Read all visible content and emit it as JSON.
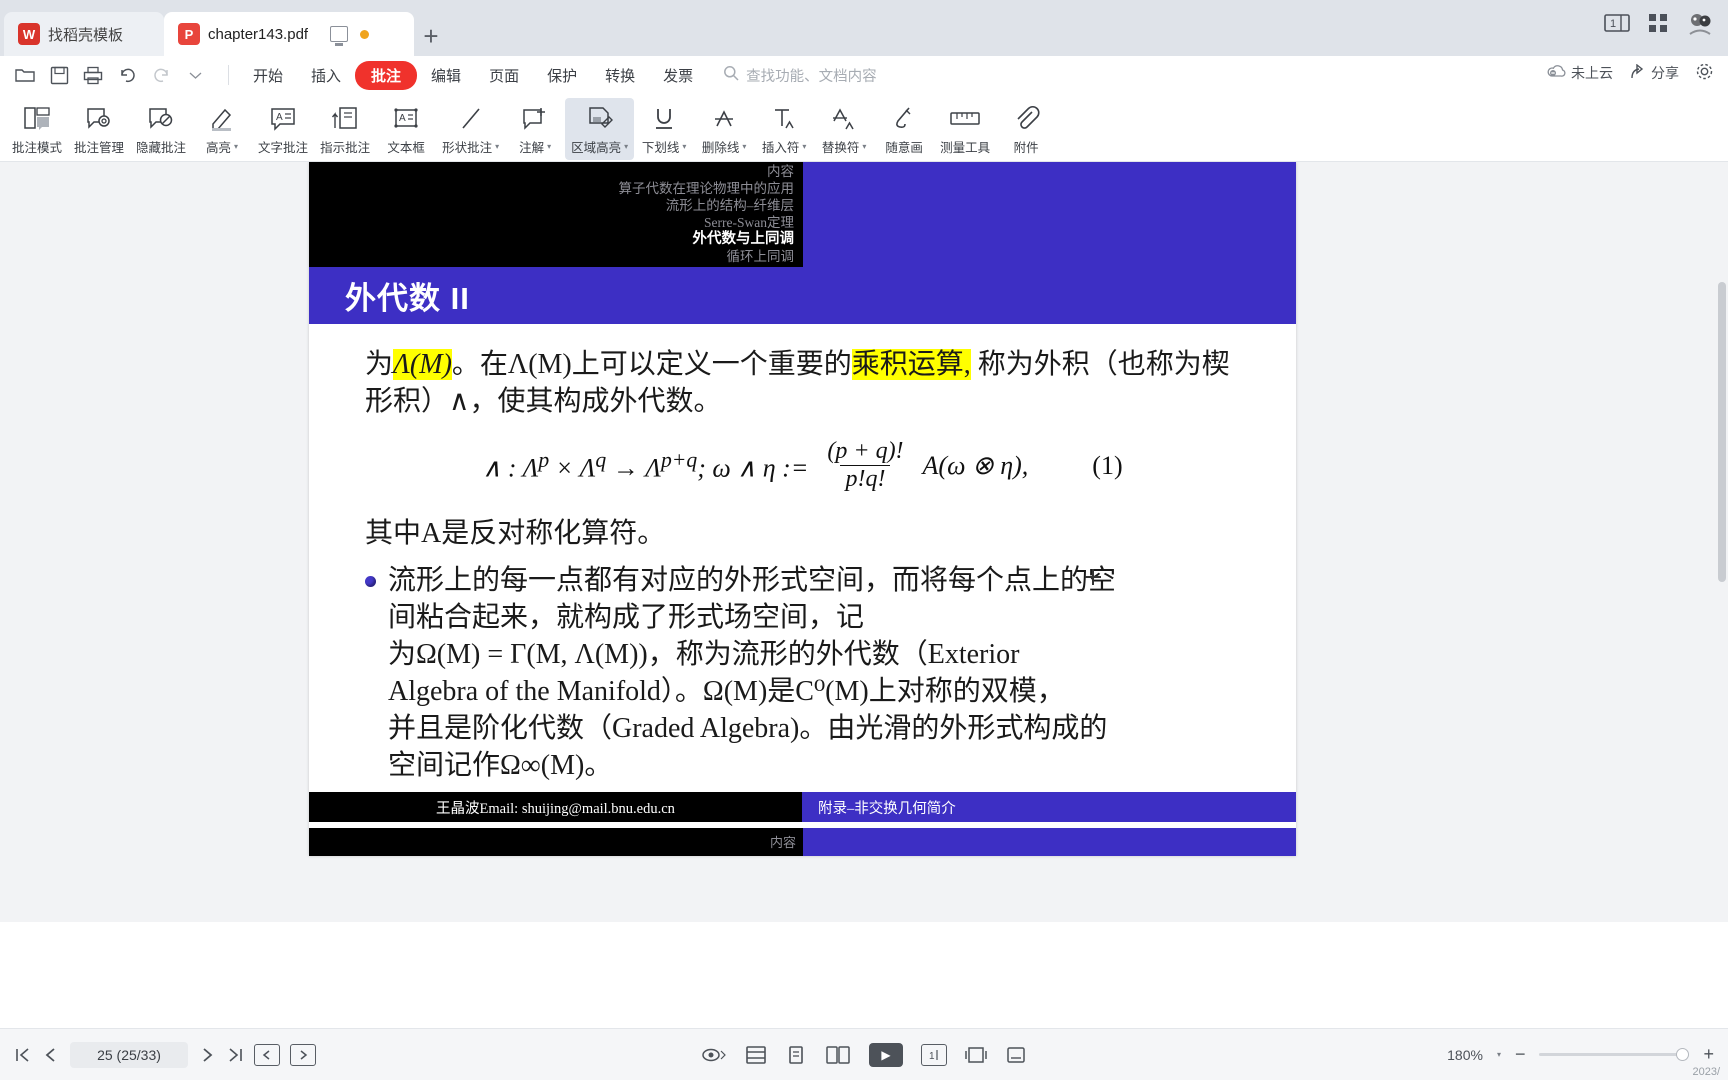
{
  "tabbar": {
    "tabs": [
      {
        "label": "找稻壳模板",
        "icon": "wps-template-icon",
        "active": false
      },
      {
        "label": "chapter143.pdf",
        "icon": "pdf-file-icon",
        "active": true
      }
    ],
    "new_tab_label": "+",
    "right_icons": [
      "single-page-view-icon",
      "grid-view-icon",
      "avatar-icon"
    ]
  },
  "menu": {
    "quick_access": [
      "open-icon",
      "save-icon",
      "print-icon",
      "undo-icon",
      "redo-icon",
      "customize-caret-icon"
    ],
    "items": [
      {
        "label": "开始",
        "active": false
      },
      {
        "label": "插入",
        "active": false
      },
      {
        "label": "批注",
        "active": true
      },
      {
        "label": "编辑",
        "active": false
      },
      {
        "label": "页面",
        "active": false
      },
      {
        "label": "保护",
        "active": false
      },
      {
        "label": "转换",
        "active": false
      },
      {
        "label": "发票",
        "active": false
      }
    ],
    "search_placeholder": "查找功能、文档内容",
    "cloud_status": "未上云",
    "share_label": "分享",
    "settings_icon": "gear-icon"
  },
  "ribbon": {
    "tools": [
      {
        "label": "批注模式",
        "icon": "comment-mode-icon",
        "caret": false,
        "selected": false
      },
      {
        "label": "批注管理",
        "icon": "comment-manage-icon",
        "caret": false,
        "selected": false
      },
      {
        "label": "隐藏批注",
        "icon": "hide-comment-icon",
        "caret": false,
        "selected": false
      },
      {
        "label": "高亮",
        "icon": "highlight-icon",
        "caret": true,
        "selected": false
      },
      {
        "label": "文字批注",
        "icon": "text-comment-icon",
        "caret": false,
        "selected": false
      },
      {
        "label": "指示批注",
        "icon": "callout-comment-icon",
        "caret": false,
        "selected": false
      },
      {
        "label": "文本框",
        "icon": "textbox-icon",
        "caret": false,
        "selected": false
      },
      {
        "label": "形状批注",
        "icon": "shape-comment-icon",
        "caret": true,
        "selected": false
      },
      {
        "label": "注解",
        "icon": "note-icon",
        "caret": true,
        "selected": false
      },
      {
        "label": "区域高亮",
        "icon": "area-highlight-icon",
        "caret": true,
        "selected": true
      },
      {
        "label": "下划线",
        "icon": "underline-icon",
        "caret": true,
        "selected": false
      },
      {
        "label": "删除线",
        "icon": "strikethrough-icon",
        "caret": true,
        "selected": false
      },
      {
        "label": "插入符",
        "icon": "insert-caret-icon",
        "caret": true,
        "selected": false
      },
      {
        "label": "替换符",
        "icon": "replace-caret-icon",
        "caret": true,
        "selected": false
      },
      {
        "label": "随意画",
        "icon": "freehand-draw-icon",
        "caret": false,
        "selected": false
      },
      {
        "label": "测量工具",
        "icon": "measure-tool-icon",
        "caret": false,
        "selected": false
      },
      {
        "label": "附件",
        "icon": "attachment-icon",
        "caret": false,
        "selected": false
      }
    ]
  },
  "slide": {
    "nav_items": [
      {
        "text": "内容",
        "current": false
      },
      {
        "text": "算子代数在理论物理中的应用",
        "current": false
      },
      {
        "text": "流形上的结构–纤维层",
        "current": false
      },
      {
        "text": "Serre-Swan定理",
        "current": false
      },
      {
        "text": "外代数与上同调",
        "current": true
      },
      {
        "text": "循环上同调",
        "current": false
      }
    ],
    "title": "外代数 II",
    "para1": {
      "p_a": "为",
      "p_b_highlighted": "Λ(M)",
      "p_c": "。在Λ(M)上可以定义一个重要的",
      "p_d_highlighted": "乘积运算,",
      "p_e": " 称为外积（也称为楔形积）∧，使其构成外代数。"
    },
    "formula": {
      "lhs": "∧ : Λ",
      "full": "∧ : Λᵖ × Λᵍ → Λᵖ⁺ᵍ; ω ∧ η := (p + q)!/(p!q!) A(ω ⊗ η),",
      "left_part": "∧ : Λ",
      "sup_p": "p",
      "times": " × Λ",
      "sup_q": "q",
      "arrow": " → Λ",
      "sup_pq": "p+q",
      "mid": "; ω ∧ η :=",
      "numerator": "(p + q)!",
      "denominator": "p!q!",
      "tail": "A(ω ⊗ η),",
      "number": "(1)"
    },
    "para2": "其中A是反对称化算符。",
    "bullet": {
      "line1": "流形上的每一点都有对应的外形式空间，而将每个点上的空",
      "line2": "间粘合起来，就构成了形式场空间，记",
      "line3": "为Ω(M) = Γ(M, Λ(M))，称为流形的外代数（Exterior",
      "line4": "Algebra of the Manifold）。Ω(M)是C⁰(M)上对称的双模，",
      "line5": "并且是阶化代数（Graded Algebra)。由光滑的外形式构成的",
      "line6": "空间记作Ω∞(M)。"
    },
    "footer_left": "王晶波Email: shuijing@mail.bnu.edu.cn",
    "footer_right": "附录–非交换几何简介",
    "next_slide_nav": "内容"
  },
  "statusbar": {
    "first_page_icon": "first-page-icon",
    "prev_page_icon": "prev-page-icon",
    "page_indicator": "25 (25/33)",
    "next_page_icon": "next-page-icon",
    "last_page_icon": "last-page-icon",
    "prev_view_icon": "prev-view-icon",
    "next_view_icon": "next-view-icon",
    "eye_protect_icon": "eye-protection-icon",
    "fit_page_icon": "fit-page-icon",
    "single_page_icon": "single-page-icon",
    "dual_page_icon": "dual-page-icon",
    "play_icon": "slideshow-play-icon",
    "one_page_icon": "one-page-mode-icon",
    "fit_width_icon": "fit-width-icon",
    "reflow_icon": "reflow-icon",
    "zoom_level": "180%",
    "zoom_out": "−",
    "zoom_in": "+",
    "version_stamp": "2023/"
  }
}
